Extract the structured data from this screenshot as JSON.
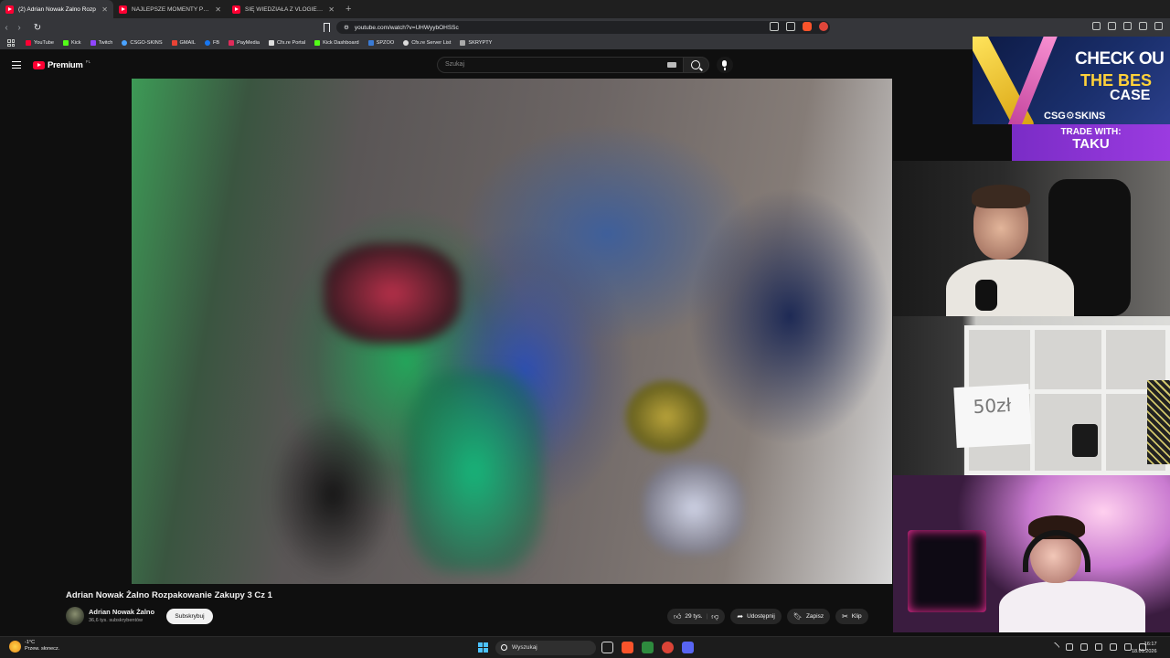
{
  "browser": {
    "tabs": [
      {
        "title": "(2) Adrian Nowak Żalno Rozp",
        "active": true
      },
      {
        "title": "NAJLEPSZE MOMENTY POLSKIEGO",
        "active": false
      },
      {
        "title": "SIĘ WIEDZIAŁA Z VLOGIEM - YouTube",
        "active": false
      }
    ],
    "url": "youtube.com/watch?v=UHWyybOHSSc",
    "bookmarks": [
      {
        "label": "YouTube",
        "color": "#ff0033"
      },
      {
        "label": "Kick",
        "color": "#53fc18"
      },
      {
        "label": "Twitch",
        "color": "#9146ff"
      },
      {
        "label": "CSGO-SKINS",
        "color": "#4aa3ff"
      },
      {
        "label": "GMAIL",
        "color": "#ea4335"
      },
      {
        "label": "FB",
        "color": "#1877f2"
      },
      {
        "label": "PayMedia",
        "color": "#e02b5a"
      },
      {
        "label": "Cfx.re Portal",
        "color": "#dddddd"
      },
      {
        "label": "Kick Dashboard",
        "color": "#53fc18"
      },
      {
        "label": "SPZOO",
        "color": "#3a7bd5"
      },
      {
        "label": "Cfx.re Server List",
        "color": "#dddddd"
      },
      {
        "label": "SKRYPTY",
        "color": "#aaaaaa"
      }
    ]
  },
  "youtube": {
    "logo_text": "Premium",
    "country_code": "PL",
    "search_placeholder": "Szukaj",
    "video_title": "Adrian Nowak Żalno Rozpakowanie Zakupy 3 Cz 1",
    "channel_name": "Adrian Nowak Żalno",
    "subscribers": "36,6 tys. subskrybentów",
    "subscribe_label": "Subskrybuj",
    "likes": "29 tys.",
    "share_label": "Udostępnij",
    "save_label": "Zapisz",
    "clip_label": "Klip"
  },
  "overlay": {
    "ad_line1": "CHECK OU",
    "ad_line2": "THE BES",
    "ad_line2b": "CASE",
    "ad_brand": "CSG⚙SKINS",
    "trade_line1": "TRADE WITH:",
    "trade_line2": "TAKU",
    "sign_text": "50zł"
  },
  "taskbar": {
    "temp": "-1°C",
    "weather": "Przew. słonecz.",
    "search_label": "Wyszukaj",
    "time": "16:17",
    "date": "18.01.2026"
  }
}
